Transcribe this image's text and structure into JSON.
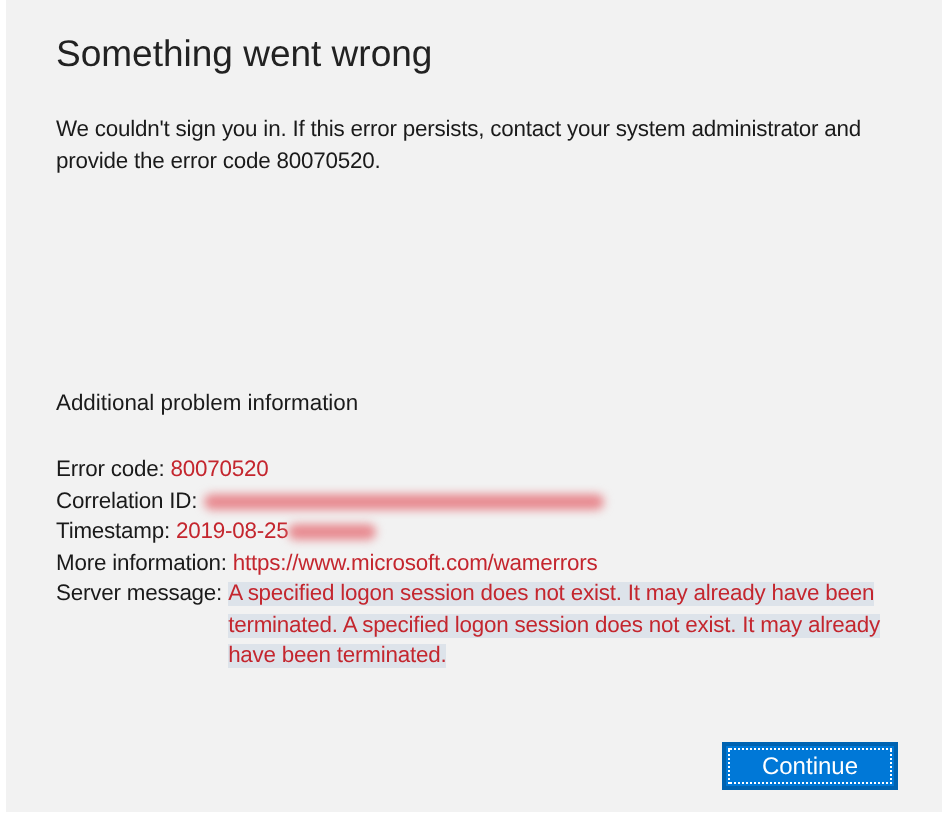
{
  "title": "Something went wrong",
  "message": "We couldn't sign you in. If this error persists, contact your system administrator and provide the error code 80070520.",
  "section_heading": "Additional problem information",
  "details": [
    {
      "label": "Error code:",
      "kind": "value",
      "value": "80070520"
    },
    {
      "label": "Correlation ID:",
      "kind": "redacted"
    },
    {
      "label": "Timestamp:",
      "kind": "partly_redacted",
      "value": "2019-08-25"
    },
    {
      "label": "More information:",
      "kind": "link",
      "value": "https://www.microsoft.com/wamerrors"
    },
    {
      "label": "Server message:",
      "kind": "message",
      "value": "A specified logon session does not exist. It may already have been terminated. A specified logon session does not exist. It may already have been terminated.",
      "highlighted": true
    }
  ],
  "button": {
    "label": "Continue",
    "focused": true
  }
}
